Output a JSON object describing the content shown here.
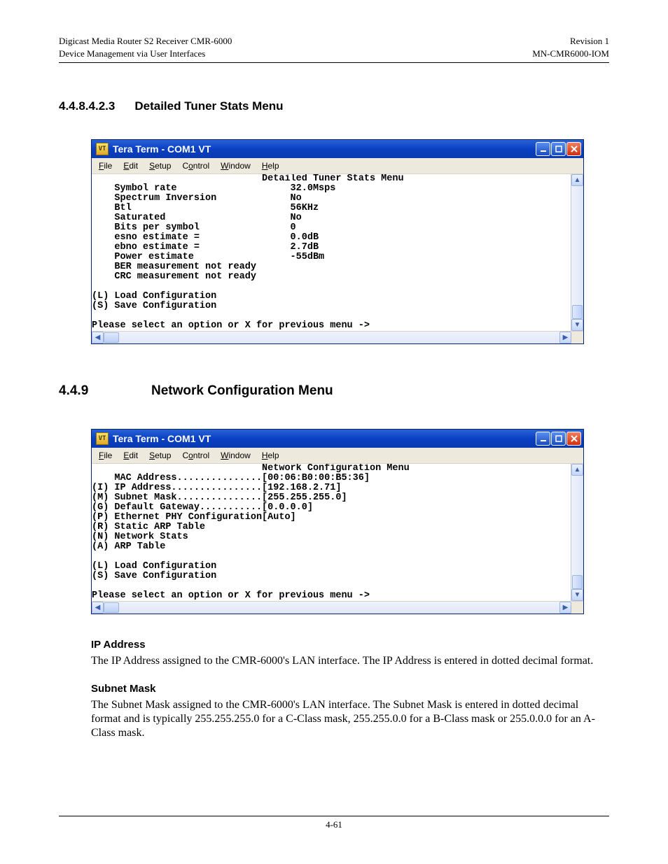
{
  "header": {
    "left_line1": "Digicast Media Router S2 Receiver CMR-6000",
    "left_line2": "Device Management via User Interfaces",
    "right_line1": "Revision 1",
    "right_line2": "MN-CMR6000-IOM"
  },
  "section1": {
    "number": "4.4.8.4.2.3",
    "title": "Detailed Tuner Stats Menu"
  },
  "section2": {
    "number": "4.4.9",
    "title": "Network Configuration Menu"
  },
  "window": {
    "title": "Tera Term - COM1 VT",
    "menus": {
      "file": "File",
      "edit": "Edit",
      "setup": "Setup",
      "control": "Control",
      "window": "Window",
      "help": "Help"
    }
  },
  "terminal1": {
    "title": "Detailed Tuner Stats Menu",
    "rows": [
      {
        "label": "Symbol rate",
        "value": "32.0Msps"
      },
      {
        "label": "Spectrum Inversion",
        "value": "No"
      },
      {
        "label": "Btl",
        "value": "56KHz"
      },
      {
        "label": "Saturated",
        "value": "No"
      },
      {
        "label": "Bits per symbol",
        "value": "0"
      },
      {
        "label": "esno estimate =",
        "value": "0.0dB"
      },
      {
        "label": "ebno estimate =",
        "value": "2.7dB"
      },
      {
        "label": "Power estimate",
        "value": "-55dBm"
      }
    ],
    "extra_lines": [
      "BER measurement not ready",
      "CRC measurement not ready"
    ],
    "options": [
      {
        "key": "L",
        "label": "Load Configuration"
      },
      {
        "key": "S",
        "label": "Save Configuration"
      }
    ],
    "prompt": "Please select an option or X for previous menu ->"
  },
  "terminal2": {
    "title": "Network Configuration Menu",
    "mac_label": "MAC Address",
    "mac_value": "00:06:B0:00:B5:36",
    "items": [
      {
        "key": "I",
        "label": "IP Address",
        "value": "192.168.2.71"
      },
      {
        "key": "M",
        "label": "Subnet Mask",
        "value": "255.255.255.0"
      },
      {
        "key": "G",
        "label": "Default Gateway",
        "value": "0.0.0.0"
      },
      {
        "key": "P",
        "label": "Ethernet PHY Configuration",
        "value": "Auto"
      },
      {
        "key": "R",
        "label": "Static ARP Table",
        "value": null
      },
      {
        "key": "N",
        "label": "Network Stats",
        "value": null
      },
      {
        "key": "A",
        "label": "ARP Table",
        "value": null
      }
    ],
    "options": [
      {
        "key": "L",
        "label": "Load Configuration"
      },
      {
        "key": "S",
        "label": "Save Configuration"
      }
    ],
    "prompt": "Please select an option or X for previous menu ->"
  },
  "body": {
    "ip_heading": "IP Address",
    "ip_text": "The IP Address assigned to the CMR-6000's LAN interface. The IP Address is entered in dotted decimal format.",
    "subnet_heading": "Subnet Mask",
    "subnet_text": "The Subnet Mask assigned to the CMR-6000's LAN interface. The Subnet Mask is entered in dotted decimal format and is typically 255.255.255.0 for a C-Class mask, 255.255.0.0 for a B-Class mask or 255.0.0.0 for an A-Class mask."
  },
  "footer": {
    "page": "4-61"
  }
}
